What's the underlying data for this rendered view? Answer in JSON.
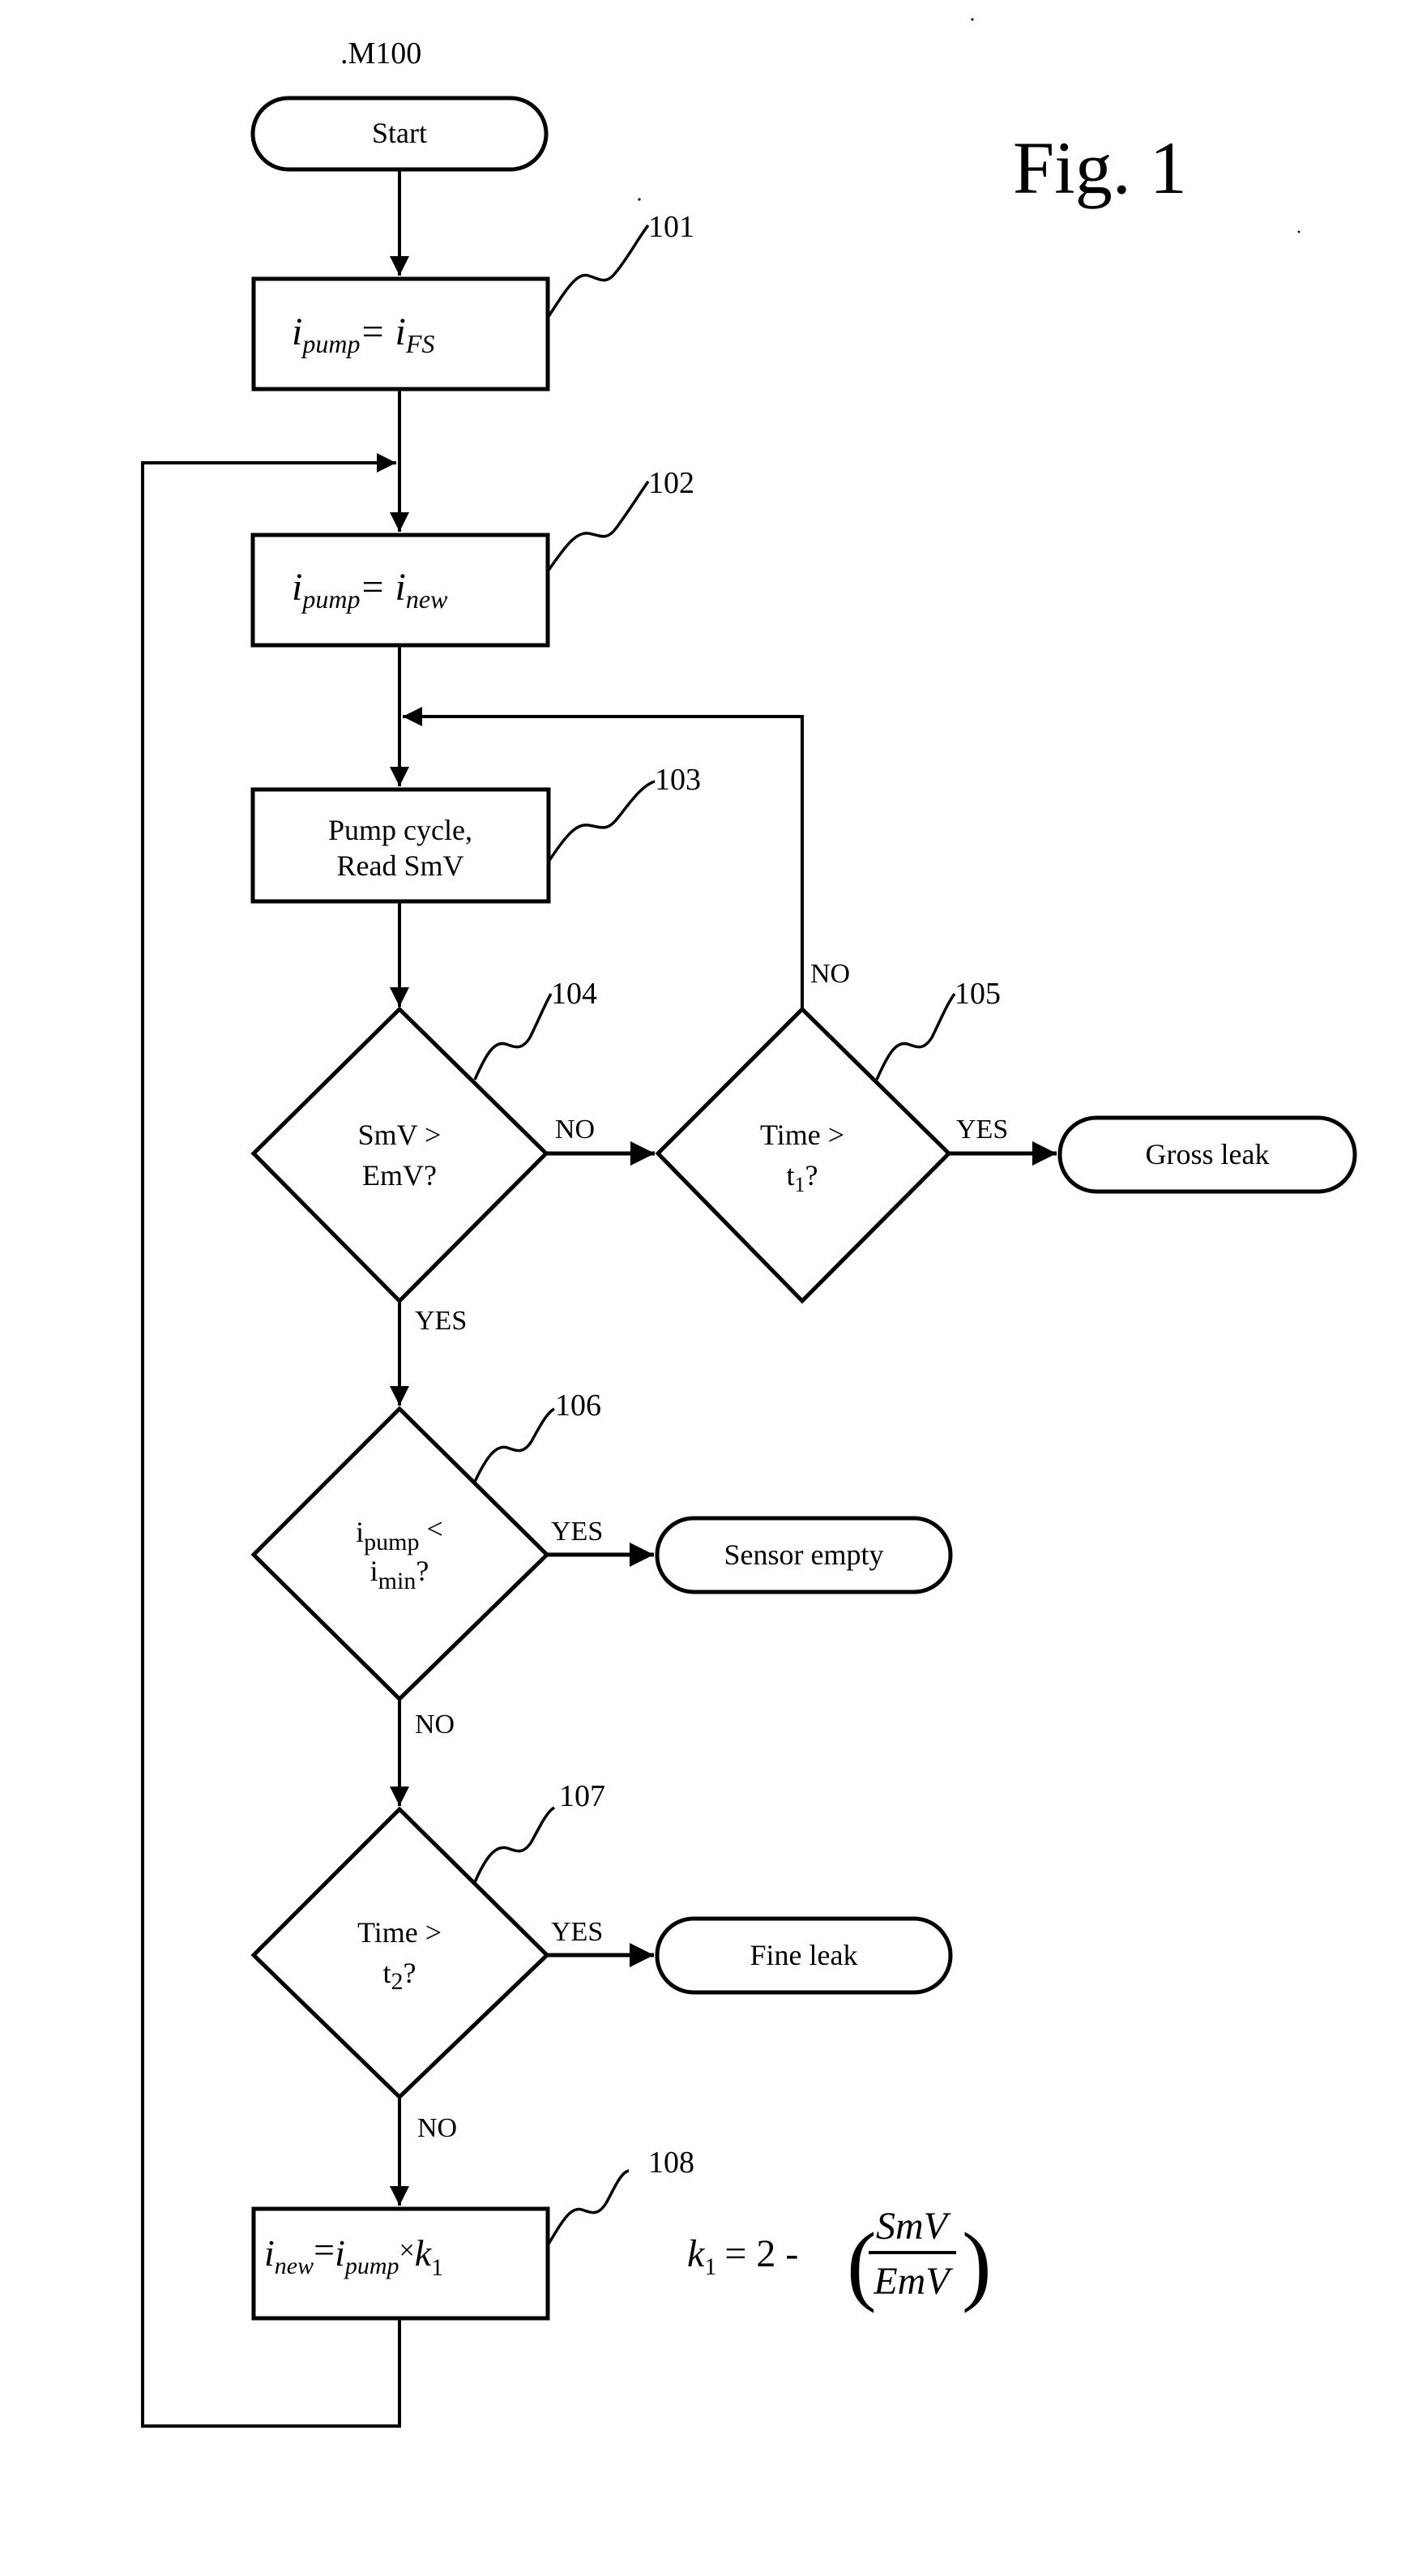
{
  "figure": {
    "title": "Fig. 1",
    "method_label": ".M100"
  },
  "nodes": {
    "start": {
      "label": "Start"
    },
    "n101": {
      "ref": "101",
      "lhs": "i",
      "lhs_sub": "pump",
      "eq": "=",
      "rhs": "i",
      "rhs_sub": "FS"
    },
    "n102": {
      "ref": "102",
      "lhs": "i",
      "lhs_sub": "pump",
      "eq": "=",
      "rhs": "i",
      "rhs_sub": "new"
    },
    "n103": {
      "ref": "103",
      "line1": "Pump cycle,",
      "line2": "Read SmV"
    },
    "n104": {
      "ref": "104",
      "line1": "SmV >",
      "line2": "EmV?"
    },
    "n105": {
      "ref": "105",
      "line1": "Time >",
      "line2_main": "t",
      "line2_sub": "1",
      "line2_end": "?"
    },
    "n106": {
      "ref": "106",
      "line1_main": "i",
      "line1_sub": "pump",
      "line1_end": " <",
      "line2_main": "i",
      "line2_sub": "min",
      "line2_end": "?"
    },
    "n107": {
      "ref": "107",
      "line1": "Time >",
      "line2_main": "t",
      "line2_sub": "2",
      "line2_end": "?"
    },
    "n108": {
      "ref": "108",
      "a": "i",
      "a_sub": "new",
      "eq": "=",
      "b": "i",
      "b_sub": "pump",
      "times": "×",
      "c": "k",
      "c_sub": "1"
    },
    "gross_leak": {
      "label": "Gross leak"
    },
    "sensor_empty": {
      "label": "Sensor empty"
    },
    "fine_leak": {
      "label": "Fine leak"
    }
  },
  "edge_labels": {
    "n104_no": "NO",
    "n104_yes": "YES",
    "n105_no": "NO",
    "n105_yes": "YES",
    "n106_yes": "YES",
    "n106_no": "NO",
    "n107_yes": "YES",
    "n107_no": "NO"
  },
  "formula": {
    "lhs": "k",
    "lhs_sub": "1",
    "eq": "= 2 -",
    "numerator": "SmV",
    "denominator": "EmV",
    "open_paren": "(",
    "close_paren": ")"
  }
}
